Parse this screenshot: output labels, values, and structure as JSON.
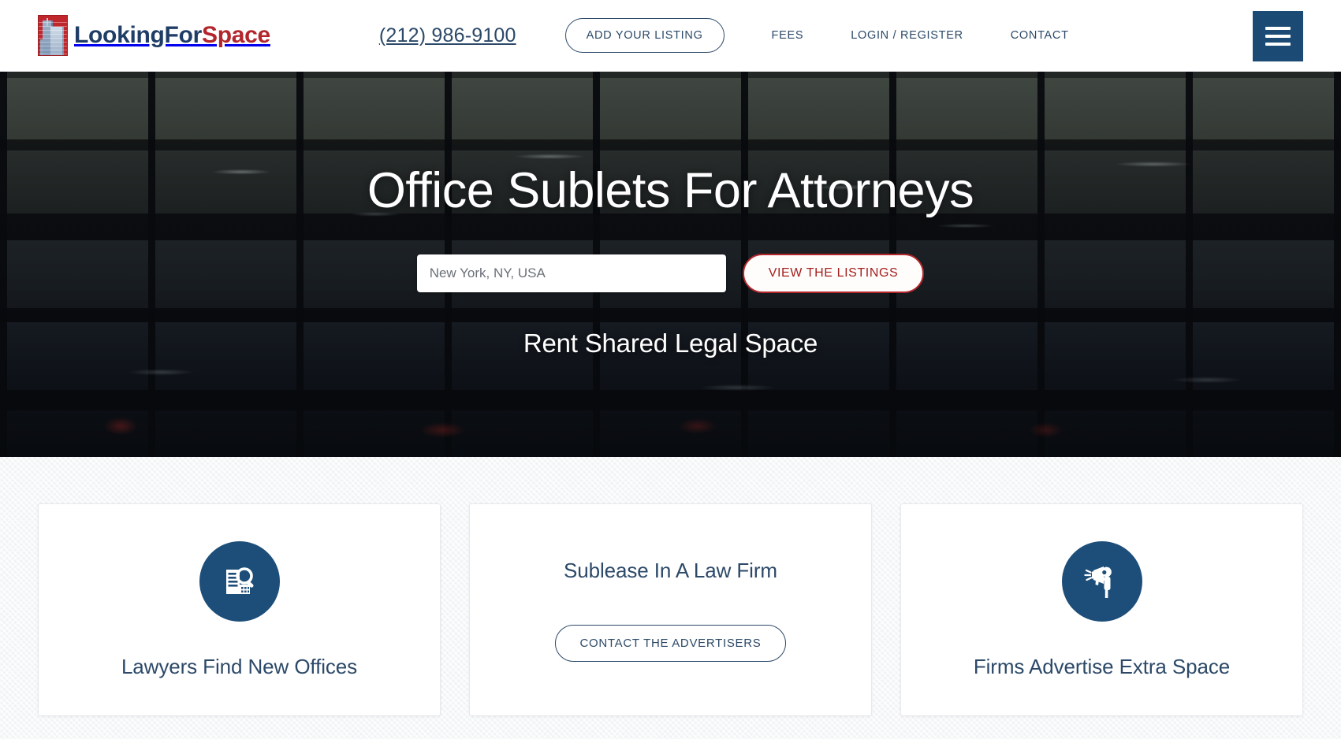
{
  "brand": {
    "name_part1": "LookingFor",
    "name_part2": "Space",
    "logo_icon": "building-logo-icon",
    "navy": "#2c4968",
    "red": "#b3262c",
    "icon_circle_navy": "#1d4e79"
  },
  "header": {
    "phone": "(212) 986-9100",
    "add_listing_label": "ADD YOUR LISTING",
    "links": [
      {
        "label": "FEES"
      },
      {
        "label": "LOGIN / REGISTER"
      },
      {
        "label": "CONTACT"
      }
    ],
    "menu_icon": "hamburger-menu-icon"
  },
  "hero": {
    "title": "Office Sublets For Attorneys",
    "search_value": "New York, NY, USA",
    "search_placeholder": "New York, NY, USA",
    "cta_label": "VIEW THE LISTINGS",
    "subtitle": "Rent Shared Legal Space"
  },
  "cards": [
    {
      "icon": "building-search-icon",
      "title": "Lawyers Find New Offices"
    },
    {
      "icon": null,
      "title": "Sublease In A Law Firm",
      "button_label": "CONTACT THE ADVERTISERS"
    },
    {
      "icon": "megaphone-announcer-icon",
      "title": "Firms Advertise Extra Space"
    }
  ]
}
